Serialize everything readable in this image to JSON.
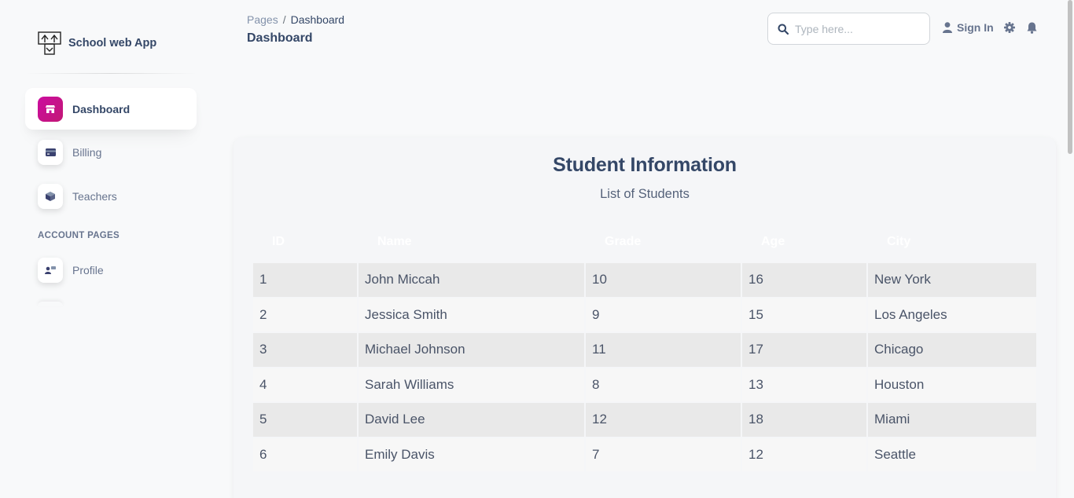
{
  "brand": {
    "name": "School web App"
  },
  "sidebar": {
    "items": [
      {
        "label": "Dashboard",
        "icon": "shop-icon"
      },
      {
        "label": "Billing",
        "icon": "credit-card-icon"
      },
      {
        "label": "Teachers",
        "icon": "box-3d-icon"
      }
    ],
    "section_title": "ACCOUNT PAGES",
    "account_items": [
      {
        "label": "Profile",
        "icon": "profile-icon"
      }
    ]
  },
  "header": {
    "breadcrumb": {
      "parent": "Pages",
      "separator": "/",
      "current": "Dashboard"
    },
    "title": "Dashboard",
    "search": {
      "placeholder": "Type here...",
      "value": ""
    },
    "signin_label": "Sign In"
  },
  "card": {
    "title": "Student Information",
    "subtitle": "List of Students",
    "table": {
      "columns": [
        "ID",
        "Name",
        "Grade",
        "Age",
        "City"
      ],
      "rows": [
        [
          "1",
          "John Miccah",
          "10",
          "16",
          "New York"
        ],
        [
          "2",
          "Jessica Smith",
          "9",
          "15",
          "Los Angeles"
        ],
        [
          "3",
          "Michael Johnson",
          "11",
          "17",
          "Chicago"
        ],
        [
          "4",
          "Sarah Williams",
          "8",
          "13",
          "Houston"
        ],
        [
          "5",
          "David Lee",
          "12",
          "18",
          "Miami"
        ],
        [
          "6",
          "Emily Davis",
          "7",
          "12",
          "Seattle"
        ]
      ]
    }
  },
  "colors": {
    "accent": "#cb0c9f",
    "text_primary": "#344767",
    "text_secondary": "#67748e",
    "background": "#f8f9fa"
  }
}
